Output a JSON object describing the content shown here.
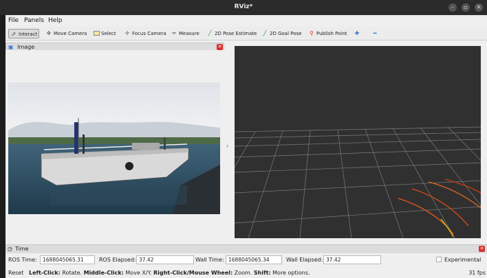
{
  "window": {
    "title": "RViz*"
  },
  "menu": [
    "File",
    "Panels",
    "Help"
  ],
  "toolbar": [
    {
      "label": "Interact",
      "icon": "cursor-icon",
      "active": true
    },
    {
      "label": "Move Camera",
      "icon": "move-camera-icon"
    },
    {
      "label": "Select",
      "icon": "select-icon"
    },
    {
      "label": "Focus Camera",
      "icon": "focus-camera-icon"
    },
    {
      "label": "Measure",
      "icon": "measure-icon"
    },
    {
      "label": "2D Pose Estimate",
      "icon": "pose-estimate-icon"
    },
    {
      "label": "2D Goal Pose",
      "icon": "goal-pose-icon"
    },
    {
      "label": "Publish Point",
      "icon": "publish-point-icon"
    }
  ],
  "image_panel": {
    "title": "Image"
  },
  "time_panel": {
    "title": "Time",
    "ros_time_label": "ROS Time:",
    "ros_time": "1688045065.31",
    "ros_elapsed_label": "ROS Elapsed:",
    "ros_elapsed": "37.42",
    "wall_time_label": "Wall Time:",
    "wall_time": "1688045065.34",
    "wall_elapsed_label": "Wall Elapsed:",
    "wall_elapsed": "37.42",
    "experimental_label": "Experimental"
  },
  "status": {
    "reset": "Reset",
    "left_click": "Left-Click:",
    "left_click_desc": "Rotate.",
    "middle_click": "Middle-Click:",
    "middle_click_desc": "Move X/Y.",
    "right_click": "Right-Click/Mouse Wheel:",
    "right_click_desc": "Zoom.",
    "shift": "Shift:",
    "shift_desc": "More options.",
    "fps": "31 fps"
  },
  "colors": {
    "grid": "#8a8a8a",
    "view_bg": "#303030",
    "trail_orange": "#e05a1a",
    "trail_yellow": "#e0c21a"
  }
}
